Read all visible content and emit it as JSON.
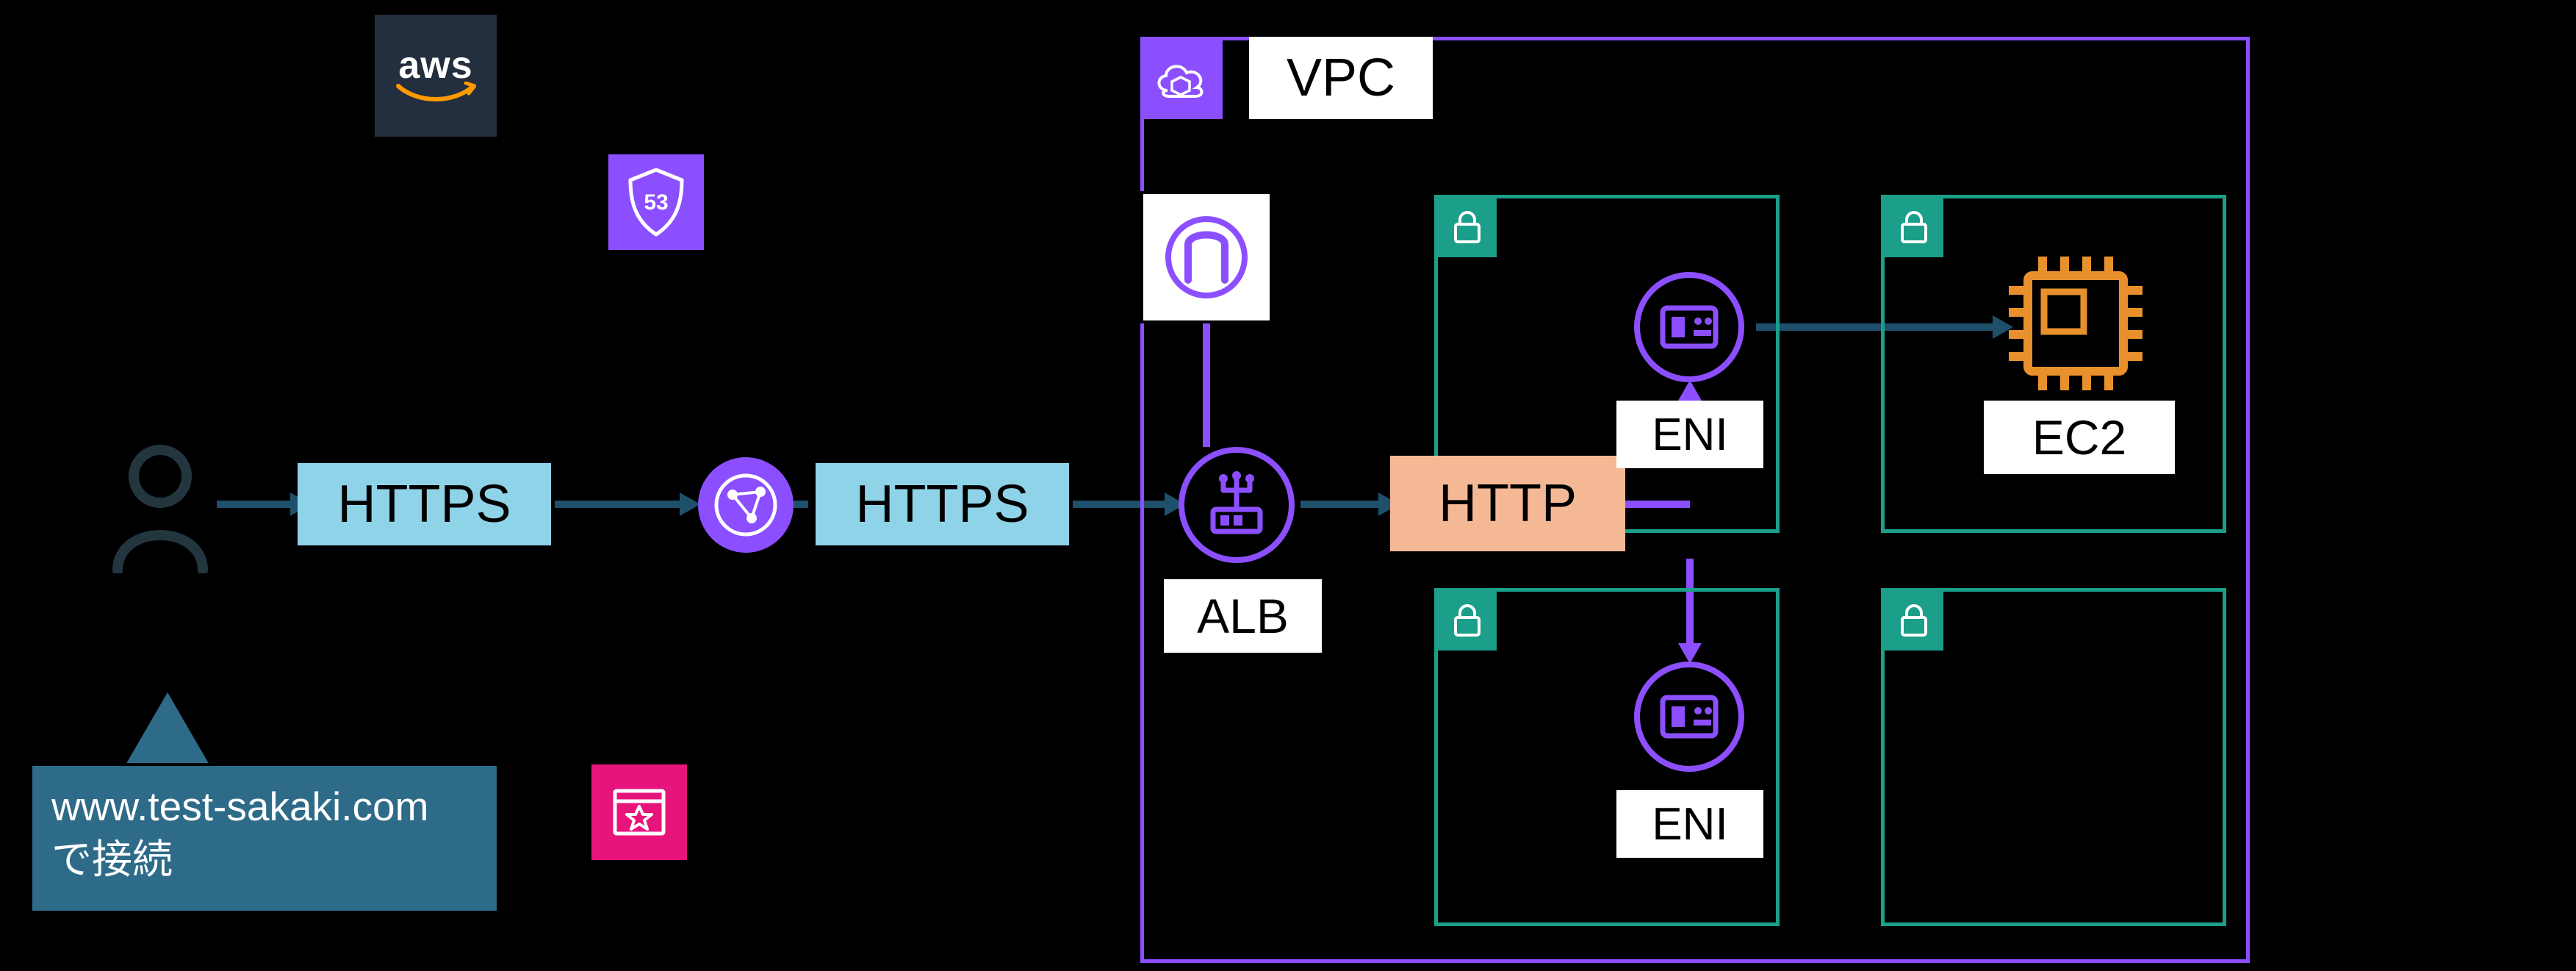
{
  "aws_logo_text": "aws",
  "vpc_label": "VPC",
  "protocol_https": "HTTPS",
  "protocol_http": "HTTP",
  "alb_label": "ALB",
  "eni_label": "ENI",
  "ec2_label": "EC2",
  "callout_line1": "www.test-sakaki.com",
  "callout_line2": "で接続",
  "icons": {
    "aws": "aws-logo-icon",
    "route53": "route53-icon",
    "vpc": "vpc-cloud-icon",
    "igw": "internet-gateway-icon",
    "cloudfront": "cloudfront-globe-icon",
    "alb": "alb-icon",
    "eni": "eni-icon",
    "ec2": "ec2-icon",
    "user": "user-icon",
    "acm": "acm-certificate-icon",
    "lock": "subnet-lock-icon"
  },
  "colors": {
    "aws_navy": "#232f3e",
    "service_purple": "#8c4fff",
    "subnet_teal": "#1b9e8a",
    "flow_blue": "#1f506b",
    "https_fill": "#8fd3e8",
    "http_fill": "#f5b895",
    "acm_pink": "#e7157b",
    "ec2_orange": "#e8912c",
    "callout_bg": "#2e6b88"
  }
}
